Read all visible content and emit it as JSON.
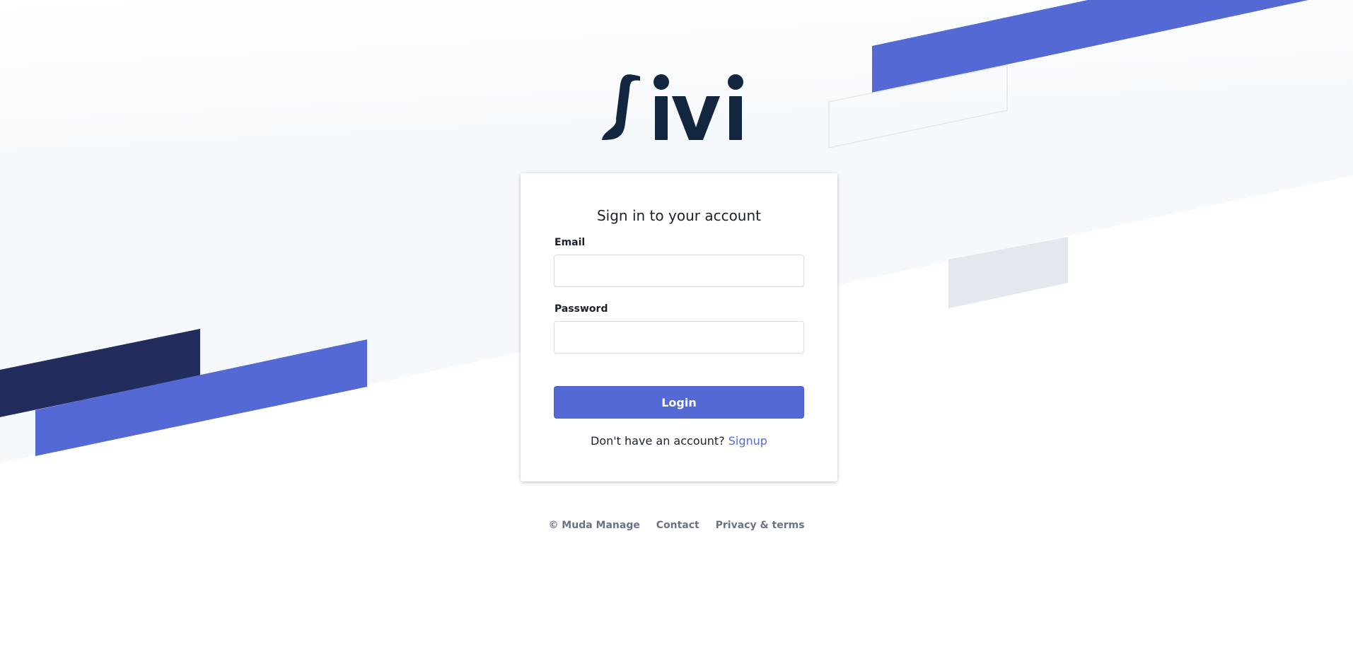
{
  "brand": {
    "logo_text": "sivi",
    "logo_color": "#12263f"
  },
  "colors": {
    "accent": "#5469d4",
    "dark_stripe": "#222d5e",
    "background_tint": "#f6f9fc",
    "text_muted": "#697386"
  },
  "form": {
    "title": "Sign in to your account",
    "email_label": "Email",
    "email_value": "",
    "password_label": "Password",
    "password_value": "",
    "login_label": "Login",
    "signup_prompt": "Don't have an account?",
    "signup_link": "Signup"
  },
  "footer": {
    "copyright": "© Muda Manage",
    "contact": "Contact",
    "privacy": "Privacy & terms"
  }
}
